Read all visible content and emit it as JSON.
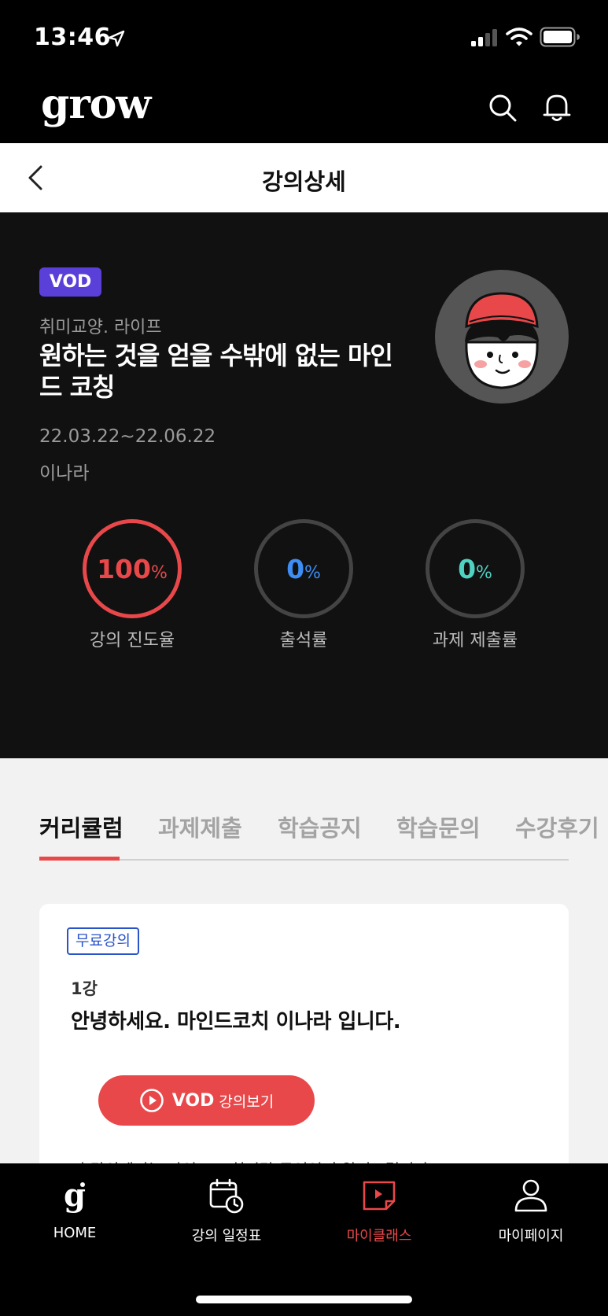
{
  "status_bar": {
    "time": "13:46"
  },
  "app_header": {
    "logo": "grow"
  },
  "title_bar": {
    "title": "강의상세"
  },
  "course": {
    "badge": "VOD",
    "category": "취미교양. 라이프",
    "title": "원하는 것을 얻을 수밖에 없는 마인드 코칭",
    "period": "22.03.22~22.06.22",
    "teacher": "이나라"
  },
  "stats": [
    {
      "value": "100",
      "unit": "%",
      "label": "강의 진도율",
      "color": "#e8484a",
      "progress": 1.0
    },
    {
      "value": "0",
      "unit": "%",
      "label": "출석률",
      "color": "#3d8df5",
      "progress": 0.0
    },
    {
      "value": "0",
      "unit": "%",
      "label": "과제 제출률",
      "color": "#4fd2c2",
      "progress": 0.0
    }
  ],
  "tabs": [
    {
      "label": "커리큘럼",
      "active": true
    },
    {
      "label": "과제제출",
      "active": false
    },
    {
      "label": "학습공지",
      "active": false
    },
    {
      "label": "학습문의",
      "active": false
    },
    {
      "label": "수강후기",
      "active": false
    }
  ],
  "lesson": {
    "badge": "무료강의",
    "number": "1강",
    "title": "안녕하세요. 마인드코치 이나라 입니다.",
    "button_strong": "VOD",
    "button_label": "강의보기",
    "more_text": "이 강의에서는 마인드 코칭이란 무엇인지 알려드립니다."
  },
  "bottom_nav": [
    {
      "label": "HOME",
      "icon": "home-g-icon",
      "active": false
    },
    {
      "label": "강의 일정표",
      "icon": "calendar-clock-icon",
      "active": false
    },
    {
      "label": "마이클래스",
      "icon": "play-screen-icon",
      "active": true
    },
    {
      "label": "마이페이지",
      "icon": "person-icon",
      "active": false
    }
  ],
  "colors": {
    "accent": "#e8484a",
    "vod_badge": "#5b3fd9",
    "free_badge": "#2953c8",
    "hero_bg": "#111111"
  }
}
